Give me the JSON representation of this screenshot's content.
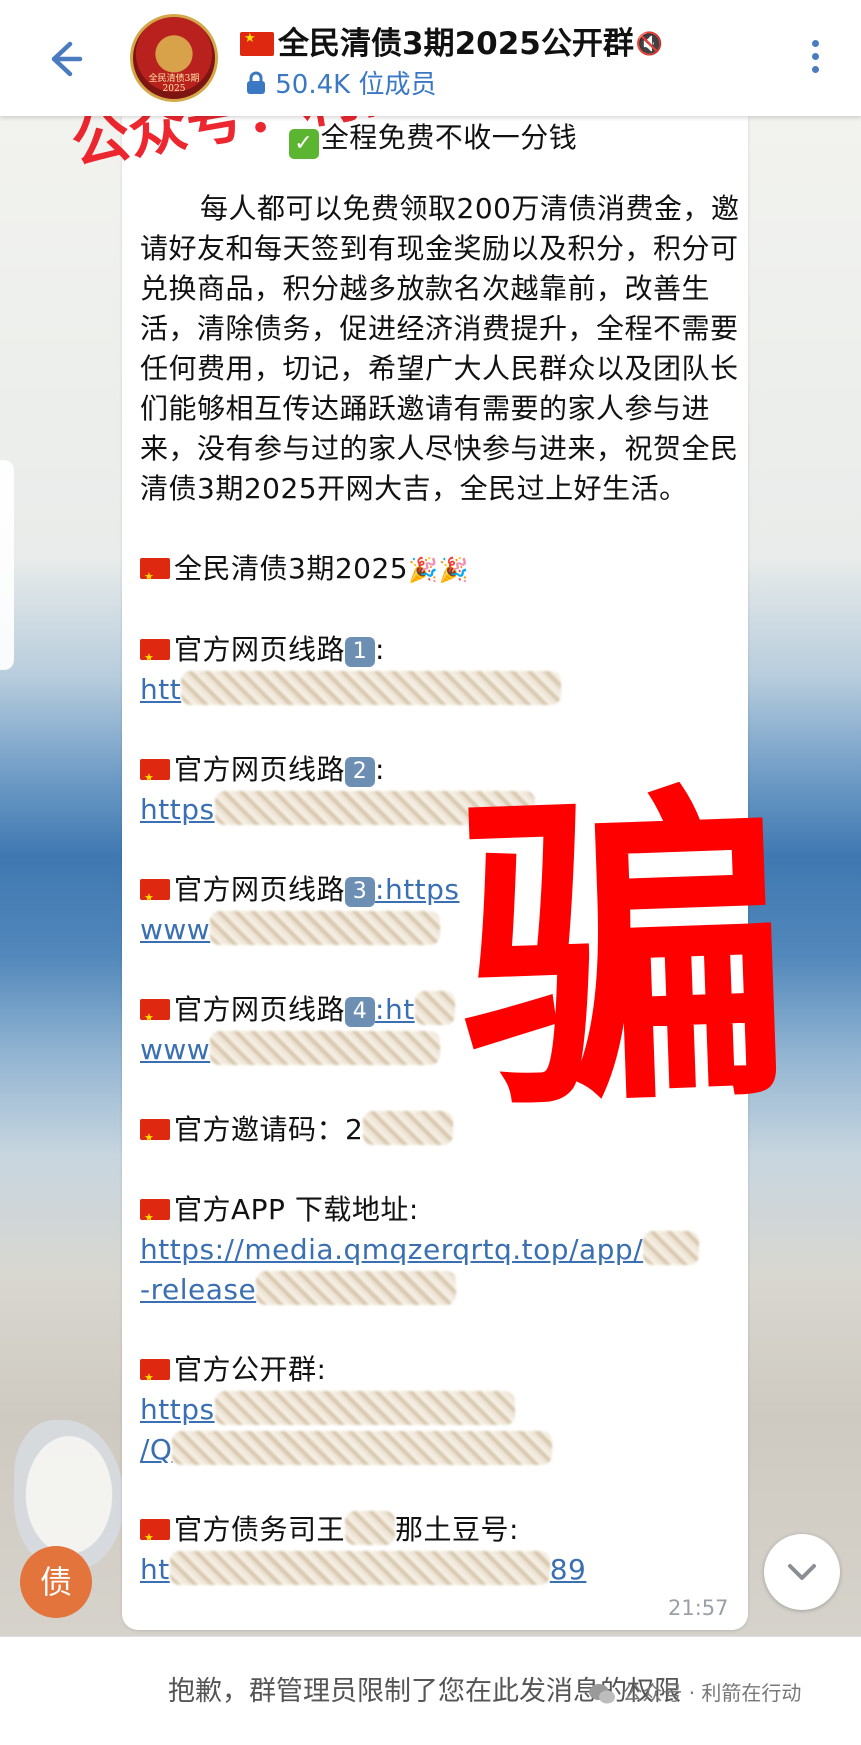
{
  "header": {
    "title": "全民清债3期2025公开群",
    "members": "50.4K 位成员"
  },
  "avatar": {
    "seal_text": "全民清债3期 2025"
  },
  "message": {
    "free_line": "全程免费不收一分钱",
    "paragraph": "每人都可以免费领取200万清债消费金，邀请好友和每天签到有现金奖励以及积分，积分可兑换商品，积分越多放款名次越靠前，改善生活，清除债务，促进经济消费提升，全程不需要任何费用，切记，希望广大人民群众以及团队长们能够相互传达踊跃邀请有需要的家人参与进来，没有参与过的家人尽快参与进来，祝贺全民清债3期2025开网大吉，全民过上好生活。",
    "heading": "全民清债3期2025",
    "route_label": "官方网页线路",
    "route1_num": "1",
    "route1_link": "htt",
    "route2_num": "2",
    "route2_link": "https",
    "route3_num": "3",
    "route3_link_a": ":https",
    "route3_link_b": "www",
    "route4_num": "4",
    "route4_link_a": ":ht",
    "route4_link_b": "www",
    "invite_label": "官方邀请码：",
    "invite_code": "2",
    "app_label": "官方APP 下载地址:",
    "app_link_a": "https://media.qmqzerqrtq.top/app/",
    "app_link_b": "-release",
    "group_label": "官方公开群:",
    "group_link_a": "https",
    "group_link_b": "/Q",
    "official_label": "官方债务司王",
    "official_label_end": "那土豆号:",
    "official_link": "ht",
    "official_link_end": "89",
    "time": "21:57"
  },
  "overlays": {
    "watermark": "公众号：利箭在行动供图",
    "stamp": "骗"
  },
  "fab": {
    "debt_label": "债"
  },
  "footer": {
    "restriction": "抱歉，群管理员限制了您在此发消息的权限",
    "source": "公众号 · 利箭在行动"
  },
  "icons": {
    "back": "arrow-left",
    "lock": "lock",
    "mute": "speaker-muted",
    "menu": "vertical-dots",
    "scroll": "chevron-down",
    "flag": "china-flag",
    "check": "check-mark",
    "party": "party-popper"
  },
  "colors": {
    "accent": "#3a78c4",
    "stamp_red": "#ff0000",
    "link": "#3a6fb2",
    "fab_orange": "#e3743b"
  }
}
